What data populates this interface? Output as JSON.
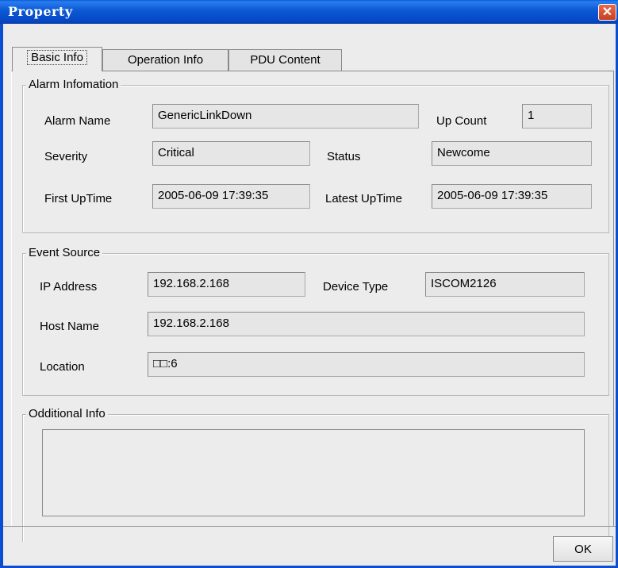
{
  "window": {
    "title": "Property",
    "close_symbol": "✕"
  },
  "tabs": [
    "Basic Info",
    "Operation Info",
    "PDU Content"
  ],
  "alarm": {
    "title": "Alarm Infomation",
    "alarm_name_label": "Alarm Name",
    "alarm_name": "GenericLinkDown",
    "up_count_label": "Up Count",
    "up_count": "1",
    "severity_label": "Severity",
    "severity": "Critical",
    "status_label": "Status",
    "status": "Newcome",
    "first_uptime_label": "First UpTime",
    "first_uptime": "2005-06-09 17:39:35",
    "latest_uptime_label": "Latest UpTime",
    "latest_uptime": "2005-06-09 17:39:35"
  },
  "event": {
    "title": "Event Source",
    "ip_label": "IP Address",
    "ip": "192.168.2.168",
    "device_type_label": "Device Type",
    "device_type": "ISCOM2126",
    "host_label": "Host Name",
    "host": "192.168.2.168",
    "location_label": "Location",
    "location": "□□:6"
  },
  "additional": {
    "title": "Odditional Info",
    "text": ""
  },
  "buttons": {
    "ok": "OK"
  },
  "colors": {
    "titlebar": "#0a5fd8",
    "close": "#d9532f",
    "panel": "#ececec"
  }
}
